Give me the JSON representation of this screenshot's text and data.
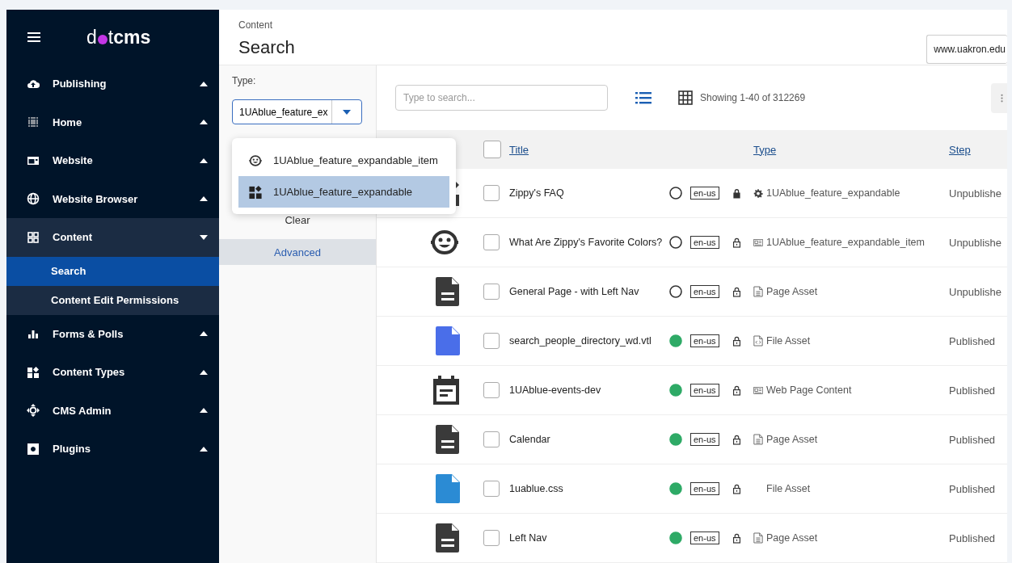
{
  "logo": {
    "prefix": "d",
    "middle": "t",
    "suffix": "cms"
  },
  "sidebar": {
    "items": [
      {
        "label": "Publishing",
        "kind": "cloud",
        "expanded": false
      },
      {
        "label": "Home",
        "kind": "dots",
        "expanded": false
      },
      {
        "label": "Website",
        "kind": "card",
        "expanded": false
      },
      {
        "label": "Website Browser",
        "kind": "globe",
        "expanded": false
      },
      {
        "label": "Content",
        "kind": "grid",
        "expanded": true,
        "children": [
          {
            "label": "Search",
            "selected": true
          },
          {
            "label": "Content Edit Permissions",
            "selected": false
          }
        ]
      },
      {
        "label": "Forms & Polls",
        "kind": "bars",
        "expanded": false
      },
      {
        "label": "Content Types",
        "kind": "blocks",
        "expanded": false
      },
      {
        "label": "CMS Admin",
        "kind": "admin",
        "expanded": false
      },
      {
        "label": "Plugins",
        "kind": "plugin",
        "expanded": false
      }
    ]
  },
  "header": {
    "breadcrumb": "Content",
    "title": "Search",
    "site": "www.uakron.edu"
  },
  "filters": {
    "type_label": "Type:",
    "type_value": "1UAblue_feature_ex",
    "clear": "Clear",
    "advanced": "Advanced",
    "dropdown": [
      {
        "label": "1UAblue_feature_expandable_item",
        "kind": "face",
        "selected": false
      },
      {
        "label": "1UAblue_feature_expandable",
        "kind": "blocks",
        "selected": true
      }
    ]
  },
  "toolbar": {
    "search_placeholder": "Type to search...",
    "showing": "Showing 1-40 of 312269"
  },
  "table": {
    "columns": [
      "Title",
      "Type",
      "Step"
    ],
    "all_checked": false,
    "rows": [
      {
        "kind": "blocks",
        "checked": false,
        "title": "Zippy's FAQ",
        "published": false,
        "lang": "en-us",
        "locked": true,
        "type": {
          "kind": "gear",
          "label": "1UAblue_feature_expandable"
        },
        "step": "Unpublishe"
      },
      {
        "kind": "face",
        "checked": false,
        "title": "What Are Zippy's Favorite Colors?",
        "published": false,
        "lang": "en-us",
        "locked": false,
        "type": {
          "kind": "card",
          "label": "1UAblue_feature_expandable_item"
        },
        "step": "Unpublishe"
      },
      {
        "kind": "page",
        "checked": false,
        "title": "General Page - with Left Nav",
        "published": false,
        "lang": "en-us",
        "locked": false,
        "type": {
          "kind": "page",
          "label": "Page Asset"
        },
        "step": "Unpublishe"
      },
      {
        "kind": "file",
        "color": "#4a6ee9",
        "checked": false,
        "title": "search_people_directory_wd.vtl",
        "published": true,
        "lang": "en-us",
        "locked": false,
        "type": {
          "kind": "code",
          "label": "File Asset"
        },
        "step": "Published"
      },
      {
        "kind": "calendar",
        "checked": false,
        "title": "1UAblue-events-dev",
        "published": true,
        "lang": "en-us",
        "locked": false,
        "type": {
          "kind": "card",
          "label": "Web Page Content"
        },
        "step": "Published"
      },
      {
        "kind": "page",
        "checked": false,
        "title": "Calendar",
        "published": true,
        "lang": "en-us",
        "locked": false,
        "type": {
          "kind": "page",
          "label": "Page Asset"
        },
        "step": "Published"
      },
      {
        "kind": "file",
        "color": "#2b8bd4",
        "checked": false,
        "title": "1uablue.css",
        "published": true,
        "lang": "en-us",
        "locked": false,
        "type": {
          "kind": "none",
          "label": "File Asset"
        },
        "step": "Published"
      },
      {
        "kind": "page",
        "checked": false,
        "title": "Left Nav",
        "published": true,
        "lang": "en-us",
        "locked": false,
        "type": {
          "kind": "page",
          "label": "Page Asset"
        },
        "step": "Published"
      }
    ]
  }
}
